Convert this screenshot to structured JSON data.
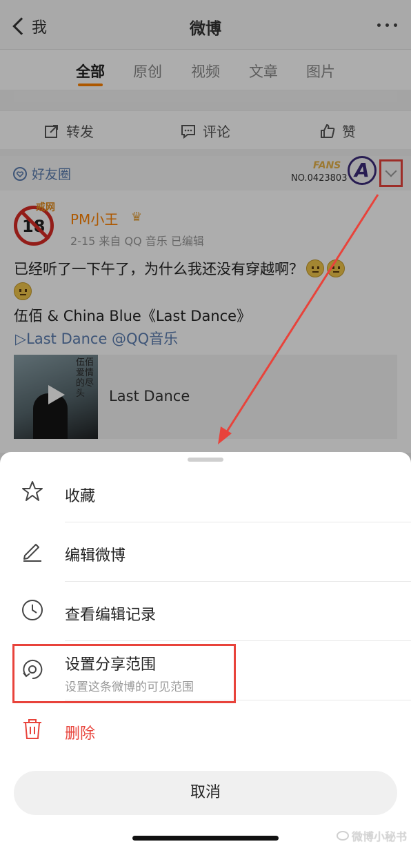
{
  "nav": {
    "back_label": "我",
    "title": "微博"
  },
  "tabs": [
    {
      "label": "全部",
      "active": true
    },
    {
      "label": "原创",
      "active": false
    },
    {
      "label": "视频",
      "active": false
    },
    {
      "label": "文章",
      "active": false
    },
    {
      "label": "图片",
      "active": false
    }
  ],
  "actions": {
    "repost": "转发",
    "comment": "评论",
    "like": "赞"
  },
  "friend_circle": {
    "label": "好友圈"
  },
  "fans_badge": {
    "word": "FANS",
    "number": "NO.0423803",
    "logo_letter": "A"
  },
  "post": {
    "user_name": "PM小王",
    "avatar_text": "18",
    "avatar_decoration": "戒网",
    "meta": "2-15  来自 QQ 音乐  已编辑",
    "text": "已经听了一下午了，为什么我还没有穿越啊？",
    "song_line": "伍佰 & China Blue《Last Dance》",
    "music_link": "▷Last Dance @QQ音乐",
    "music_card_title": "Last Dance",
    "album_cover_text": "伍佰 爱情的尽头"
  },
  "sheet": {
    "items": [
      {
        "label": "收藏",
        "icon": "star-icon"
      },
      {
        "label": "编辑微博",
        "icon": "pencil-icon"
      },
      {
        "label": "查看编辑记录",
        "icon": "clock-icon"
      },
      {
        "label": "设置分享范围",
        "sublabel": "设置这条微博的可见范围",
        "icon": "share-scope-icon"
      },
      {
        "label": "删除",
        "icon": "trash-icon",
        "danger": true
      }
    ],
    "cancel_label": "取消"
  },
  "watermark": "微博小秘书",
  "colors": {
    "accent": "#ff8200",
    "link": "#5a7db0",
    "danger": "#e8433b",
    "annotation": "#e8433b"
  }
}
